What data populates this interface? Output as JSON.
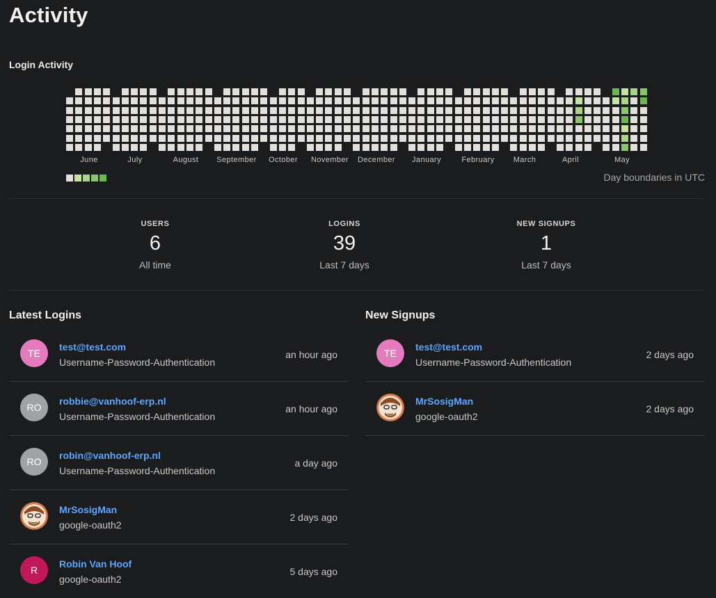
{
  "page": {
    "title": "Activity"
  },
  "login_activity": {
    "title": "Login Activity",
    "months": [
      "June",
      "July",
      "August",
      "September",
      "October",
      "November",
      "December",
      "January",
      "February",
      "March",
      "April",
      "May"
    ],
    "utc_note": "Day boundaries in UTC",
    "colors": {
      "empty": "#e3e0dc",
      "level1": "#c6e2a6",
      "level2": "#a9d48a",
      "level3": "#8cc56e",
      "level4": "#6eb654"
    }
  },
  "stats": [
    {
      "label": "USERS",
      "value": "6",
      "sub": "All time"
    },
    {
      "label": "LOGINS",
      "value": "39",
      "sub": "Last 7 days"
    },
    {
      "label": "NEW SIGNUPS",
      "value": "1",
      "sub": "Last 7 days"
    }
  ],
  "latest_logins": {
    "title": "Latest Logins",
    "rows": [
      {
        "initials": "TE",
        "avatar": "initials",
        "avatar_color": "#e47bbf",
        "name": "test@test.com",
        "method": "Username-Password-Authentication",
        "time": "an hour ago"
      },
      {
        "initials": "RO",
        "avatar": "initials",
        "avatar_color": "#9ea4a5",
        "name": "robbie@vanhoof-erp.nl",
        "method": "Username-Password-Authentication",
        "time": "an hour ago"
      },
      {
        "initials": "RO",
        "avatar": "initials",
        "avatar_color": "#9ea4a5",
        "name": "robin@vanhoof-erp.nl",
        "method": "Username-Password-Authentication",
        "time": "a day ago"
      },
      {
        "initials": "",
        "avatar": "cartoon-face",
        "avatar_color": "#d9794a",
        "name": "MrSosigMan",
        "method": "google-oauth2",
        "time": "2 days ago"
      },
      {
        "initials": "R",
        "avatar": "initials",
        "avatar_color": "#c2185b",
        "name": "Robin Van Hoof",
        "method": "google-oauth2",
        "time": "5 days ago"
      }
    ]
  },
  "new_signups": {
    "title": "New Signups",
    "rows": [
      {
        "initials": "TE",
        "avatar": "initials",
        "avatar_color": "#e47bbf",
        "name": "test@test.com",
        "method": "Username-Password-Authentication",
        "time": "2 days ago"
      },
      {
        "initials": "",
        "avatar": "cartoon-face",
        "avatar_color": "#d9794a",
        "name": "MrSosigMan",
        "method": "google-oauth2",
        "time": "2 days ago"
      }
    ]
  }
}
